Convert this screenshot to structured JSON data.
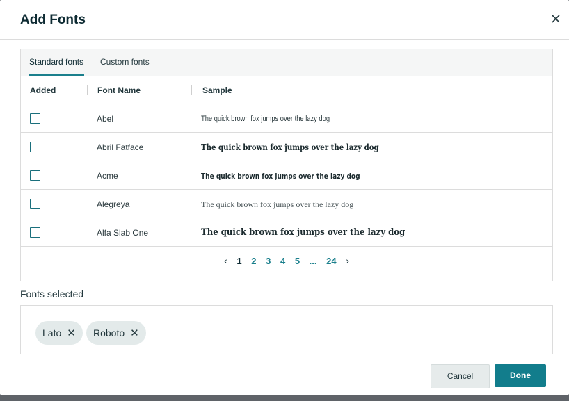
{
  "dialog": {
    "title": "Add Fonts"
  },
  "tabs": [
    {
      "label": "Standard fonts",
      "active": true
    },
    {
      "label": "Custom fonts",
      "active": false
    }
  ],
  "table": {
    "columns": [
      "Added",
      "Font Name",
      "Sample"
    ],
    "rows": [
      {
        "added": false,
        "font_name": "Abel",
        "sample": "The quick brown fox jumps over the lazy dog"
      },
      {
        "added": false,
        "font_name": "Abril Fatface",
        "sample": "The quick brown fox jumps over the lazy dog"
      },
      {
        "added": false,
        "font_name": "Acme",
        "sample": "The quick brown fox jumps over the lazy dog"
      },
      {
        "added": false,
        "font_name": "Alegreya",
        "sample": "The quick brown fox jumps over the lazy dog"
      },
      {
        "added": false,
        "font_name": "Alfa Slab One",
        "sample": "The quick brown fox jumps over the lazy dog"
      }
    ]
  },
  "pagination": {
    "prev_icon": "chevron-left-icon",
    "next_icon": "chevron-right-icon",
    "pages": [
      "1",
      "2",
      "3",
      "4",
      "5"
    ],
    "ellipsis": "...",
    "last": "24",
    "current": "1"
  },
  "selected": {
    "label": "Fonts selected",
    "chips": [
      {
        "label": "Lato"
      },
      {
        "label": "Roboto"
      }
    ]
  },
  "footer": {
    "cancel_label": "Cancel",
    "done_label": "Done"
  },
  "colors": {
    "accent": "#127d8c",
    "title": "#0e2b33",
    "chip_bg": "#e3eaea",
    "overlay": "#5f6368"
  }
}
